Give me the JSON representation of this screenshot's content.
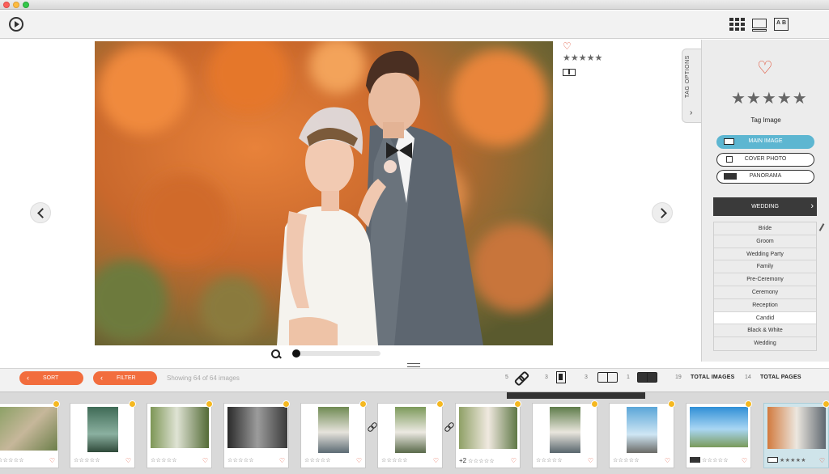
{
  "window": {
    "controls": [
      "close",
      "minimize",
      "zoom"
    ]
  },
  "toolbar": {
    "play_icon": "play-circle-icon",
    "view_icons": [
      "grid-view-icon",
      "single-view-icon",
      "compare-ab-icon"
    ],
    "ab_letters": {
      "a": "A",
      "b": "B"
    }
  },
  "viewer": {
    "prev_icon": "chevron-left-icon",
    "next_icon": "chevron-right-icon",
    "side_tags": {
      "heart": "♡",
      "stars": "★★★★★"
    },
    "zoom_level": 0.0
  },
  "panel": {
    "tab_label": "TAG OPTIONS",
    "tab_chevron": "›",
    "heart": "♡",
    "stars": "★★★★★",
    "tag_image_label": "Tag Image",
    "buttons": [
      {
        "label": "MAIN IMAGE",
        "active": true
      },
      {
        "label": "COVER PHOTO",
        "active": false
      },
      {
        "label": "PANORAMA",
        "active": false
      }
    ],
    "category_header": "WEDDING",
    "category_chevron": "›",
    "categories": [
      "Bride",
      "Groom",
      "Wedding Party",
      "Family",
      "Pre-Ceremony",
      "Ceremony",
      "Reception",
      "Candid",
      "Black & White",
      "Wedding"
    ],
    "selected_category": "Candid"
  },
  "bottombar": {
    "sort_label": "SORT",
    "filter_label": "FILTER",
    "chevron": "‹",
    "showing_text": "Showing 64 of 64 images",
    "counts": {
      "links": "5",
      "pages": "3",
      "spreads": "3",
      "panoramas": "1"
    },
    "total_images_count": "19",
    "total_images_label": "TOTAL IMAGES",
    "total_pages_count": "14",
    "total_pages_label": "TOTAL PAGES"
  },
  "filmstrip": {
    "stars": "☆☆☆☆☆",
    "heart": "♡",
    "items": [
      {
        "extra": ""
      },
      {
        "extra": ""
      },
      {
        "extra": ""
      },
      {
        "extra": ""
      },
      {
        "extra": ""
      },
      {
        "extra": ""
      },
      {
        "extra": "+2"
      },
      {
        "extra": ""
      },
      {
        "extra": ""
      },
      {
        "extra": ""
      },
      {
        "extra": ""
      }
    ]
  },
  "colors": {
    "accent": "#f26d3d",
    "active_button": "#5db6d1",
    "heart": "#e0533a",
    "dark": "#3a3a3a"
  }
}
